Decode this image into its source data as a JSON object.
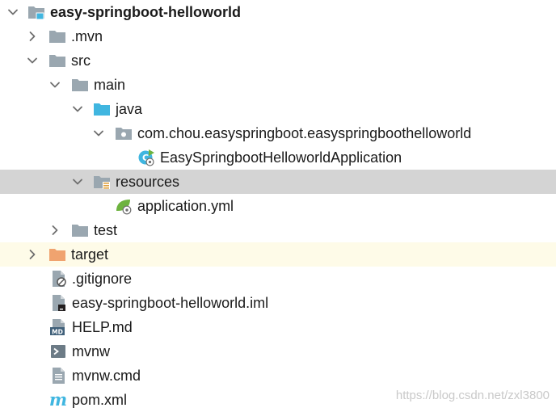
{
  "project": {
    "name": "easy-springboot-helloworld"
  },
  "tree": {
    "mvn": ".mvn",
    "src": "src",
    "main": "main",
    "java": "java",
    "package": "com.chou.easyspringboot.easyspringboothelloworld",
    "app_class": "EasySpringbootHelloworldApplication",
    "resources": "resources",
    "app_yml": "application.yml",
    "test": "test",
    "target": "target",
    "gitignore": ".gitignore",
    "iml": "easy-springboot-helloworld.iml",
    "help": "HELP.md",
    "mvnw": "mvnw",
    "mvnw_cmd": "mvnw.cmd",
    "pom": "pom.xml"
  },
  "colors": {
    "folder": "#9aa7b0",
    "source_folder": "#40b6e0",
    "excluded_folder": "#f0a36f",
    "selected_row": "#d4d4d4",
    "ignored_row": "#fefbe8",
    "spring_green": "#6db33f"
  },
  "icons": {
    "expanded": "chevron-down-icon",
    "collapsed": "chevron-right-icon",
    "folder": "folder-icon",
    "module": "module-folder-icon",
    "source": "source-folder-icon",
    "package": "package-icon",
    "spring_class": "spring-boot-class-icon",
    "resources": "resources-folder-icon",
    "yaml": "spring-config-icon",
    "excluded": "excluded-folder-icon",
    "ignore": "ignore-file-icon",
    "module_file": "module-file-icon",
    "markdown": "markdown-file-icon",
    "shell": "shell-script-icon",
    "text": "text-file-icon",
    "maven": "maven-icon"
  },
  "watermark": "https://blog.csdn.net/zxl3800"
}
